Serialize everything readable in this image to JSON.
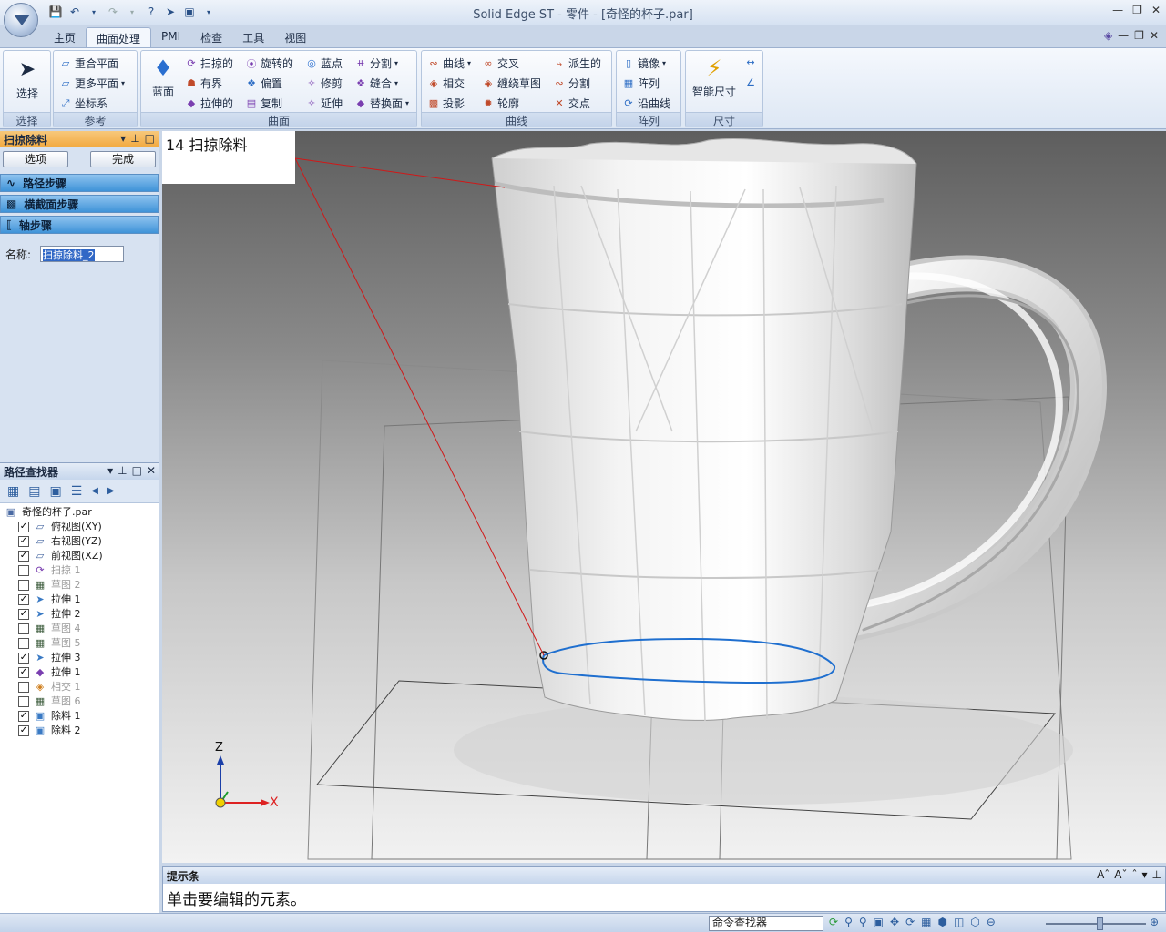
{
  "window": {
    "title": "Solid Edge ST - 零件 - [奇怪的杯子.par]"
  },
  "tabs": [
    "主页",
    "曲面处理",
    "PMI",
    "检查",
    "工具",
    "视图"
  ],
  "ribbon": {
    "select": {
      "label": "选择",
      "group": "选择"
    },
    "reference": {
      "group": "参考",
      "items": [
        "重合平面",
        "更多平面",
        "坐标系"
      ]
    },
    "surface": {
      "group": "曲面",
      "bluebody": "蓝面",
      "items": [
        "扫掠的",
        "有界",
        "拉伸的",
        "旋转的",
        "偏置",
        "复制",
        "蓝点",
        "修剪",
        "延伸",
        "分割",
        "缝合",
        "替换面"
      ]
    },
    "curves": {
      "group": "曲线",
      "items": [
        "曲线",
        "相交",
        "投影",
        "交叉",
        "缠绕草图",
        "轮廓",
        "派生的",
        "分割",
        "交点"
      ]
    },
    "pattern": {
      "group": "阵列",
      "items": [
        "镜像",
        "阵列",
        "沿曲线"
      ]
    },
    "dimension": {
      "group": "尺寸",
      "smart": "智能尺寸"
    }
  },
  "command_pane": {
    "title": "扫掠除料",
    "options_button": "选项",
    "finish_button": "完成",
    "steps": [
      "路径步骤",
      "横截面步骤",
      "轴步骤"
    ],
    "name_label": "名称:",
    "name_value": "扫掠除料_2"
  },
  "pathfinder": {
    "title": "路径查找器",
    "root": "奇怪的杯子.par",
    "items": [
      {
        "label": "俯视图(XY)",
        "checked": true,
        "enabled": true,
        "icon": "plane-icon"
      },
      {
        "label": "右视图(YZ)",
        "checked": true,
        "enabled": true,
        "icon": "plane-icon"
      },
      {
        "label": "前视图(XZ)",
        "checked": true,
        "enabled": true,
        "icon": "plane-icon"
      },
      {
        "label": "扫掠 1",
        "checked": false,
        "enabled": false,
        "icon": "sweep-icon"
      },
      {
        "label": "草图 2",
        "checked": false,
        "enabled": false,
        "icon": "sketch-icon"
      },
      {
        "label": "拉伸 1",
        "checked": true,
        "enabled": true,
        "icon": "extrude-icon"
      },
      {
        "label": "拉伸 2",
        "checked": true,
        "enabled": true,
        "icon": "extrude-icon"
      },
      {
        "label": "草图 4",
        "checked": false,
        "enabled": false,
        "icon": "sketch-icon"
      },
      {
        "label": "草图 5",
        "checked": false,
        "enabled": false,
        "icon": "sketch-icon"
      },
      {
        "label": "拉伸 3",
        "checked": true,
        "enabled": true,
        "icon": "extrude-icon"
      },
      {
        "label": "拉伸 1",
        "checked": true,
        "enabled": true,
        "icon": "extrude-purple-icon"
      },
      {
        "label": "相交 1",
        "checked": false,
        "enabled": false,
        "icon": "intersect-icon"
      },
      {
        "label": "草图 6",
        "checked": false,
        "enabled": false,
        "icon": "sketch-icon"
      },
      {
        "label": "除料 1",
        "checked": true,
        "enabled": true,
        "icon": "cutout-icon"
      },
      {
        "label": "除料 2",
        "checked": true,
        "enabled": true,
        "icon": "cutout-icon"
      }
    ]
  },
  "viewport": {
    "callout": "14 扫掠除料",
    "axis_z": "Z",
    "axis_x": "X"
  },
  "prompt": {
    "title": "提示条",
    "text": "单击要编辑的元素。"
  },
  "statusbar": {
    "command_finder": "命令查找器"
  }
}
